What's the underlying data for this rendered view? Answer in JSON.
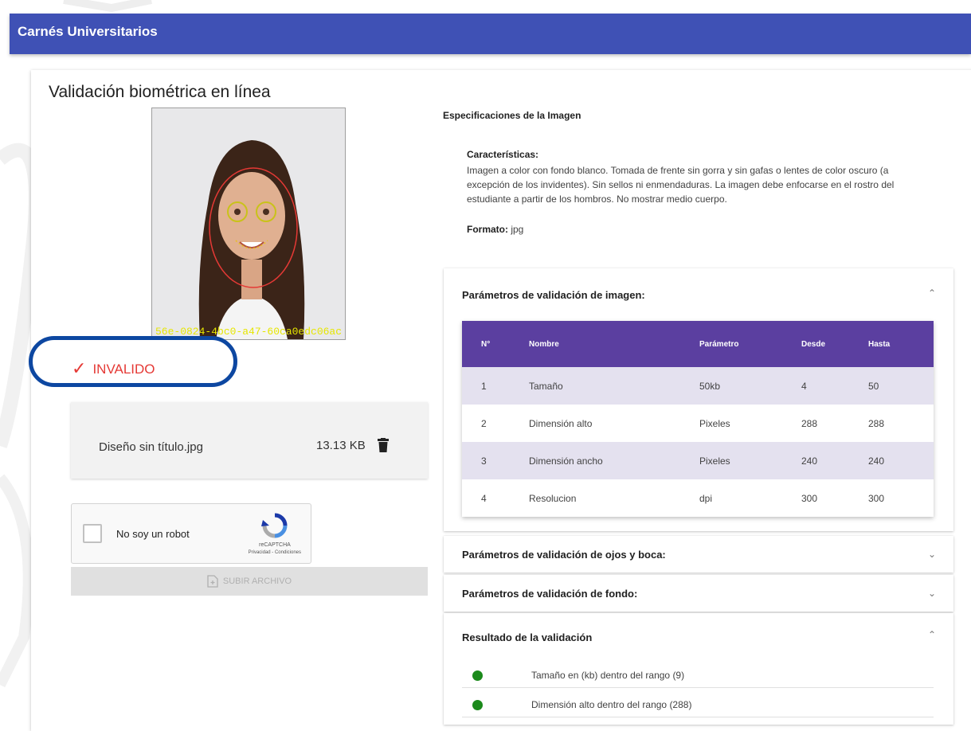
{
  "app": {
    "title": "Carnés Universitarios"
  },
  "page": {
    "title": "Validación biométrica en línea"
  },
  "photo": {
    "overlay_id": "56e-0824-4bc0-a47-60ca0edc06ac"
  },
  "status": {
    "label": "INVALIDO",
    "icon": "check-icon",
    "color": "#e53935"
  },
  "file": {
    "name": "Diseño sin título.jpg",
    "size": "13.13 KB",
    "icon": "trash-icon"
  },
  "captcha": {
    "label": "No soy un robot",
    "brand": "reCAPTCHA",
    "terms": "Privacidad - Condiciones"
  },
  "upload": {
    "label": "SUBIR ARCHIVO"
  },
  "spec": {
    "title": "Especificaciones de la Imagen",
    "characteristics_label": "Características:",
    "characteristics_text": "Imagen a color con fondo blanco. Tomada de frente sin gorra y sin gafas o lentes de color oscuro (a excepción de los invidentes). Sin sellos ni enmendaduras. La imagen debe enfocarse en el rostro del estudiante a partir de los hombros. No mostrar medio cuerpo.",
    "format_label": "Formato:",
    "format_value": "jpg"
  },
  "panels": {
    "image_params": {
      "title": "Parámetros de validación de imagen:",
      "headers": [
        "N°",
        "Nombre",
        "Parámetro",
        "Desde",
        "Hasta"
      ],
      "rows": [
        [
          "1",
          "Tamaño",
          "50kb",
          "4",
          "50"
        ],
        [
          "2",
          "Dimensión alto",
          "Pixeles",
          "288",
          "288"
        ],
        [
          "3",
          "Dimensión ancho",
          "Pixeles",
          "240",
          "240"
        ],
        [
          "4",
          "Resolucion",
          "dpi",
          "300",
          "300"
        ]
      ]
    },
    "eyes_mouth": {
      "title": "Parámetros de validación de ojos y boca:"
    },
    "background": {
      "title": "Parámetros de validación de fondo:"
    },
    "result": {
      "title": "Resultado de la validación",
      "items": [
        "Tamaño en (kb) dentro del rango (9)",
        "Dimensión alto dentro del rango (288)"
      ]
    }
  },
  "colors": {
    "header": "#3f51b5",
    "table_header": "#5b3fa0",
    "status_ok": "#1b8a1b",
    "highlight_ring": "#0d47a1"
  }
}
